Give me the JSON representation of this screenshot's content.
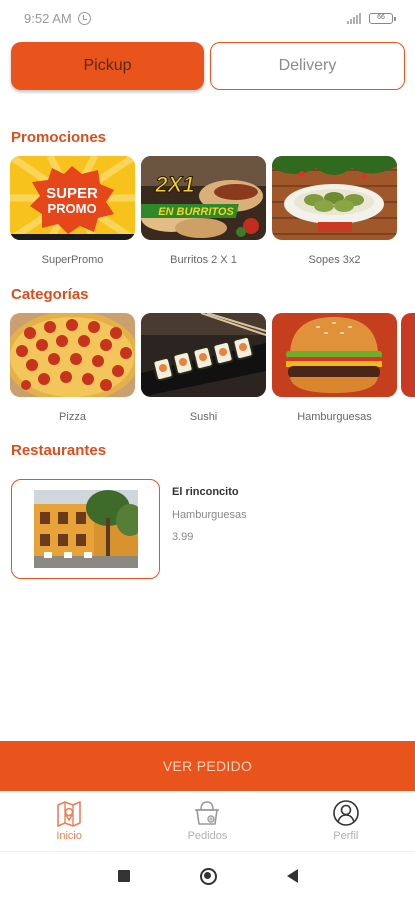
{
  "status_bar": {
    "time": "9:52 AM",
    "battery": "66"
  },
  "toggle": {
    "pickup": "Pickup",
    "delivery": "Delivery"
  },
  "sections": {
    "promotions": "Promociones",
    "categories": "Categorías",
    "restaurants": "Restaurantes"
  },
  "promotions": [
    {
      "label": "SuperPromo",
      "art_line1": "SUPER",
      "art_line2": "PROMO"
    },
    {
      "label": "Burritos 2 X 1",
      "art_line1": "2X1",
      "art_line2": "EN BURRITOS"
    },
    {
      "label": "Sopes 3x2"
    }
  ],
  "categories": [
    {
      "label": "Pizza"
    },
    {
      "label": "Sushi"
    },
    {
      "label": "Hamburguesas"
    }
  ],
  "restaurant": {
    "name": "El rinconcito",
    "category": "Hamburguesas",
    "price": "3.99"
  },
  "order_button": "VER PEDIDO",
  "bottom_nav": [
    {
      "label": "Inicio",
      "icon": "map-icon"
    },
    {
      "label": "Pedidos",
      "icon": "basket-icon"
    },
    {
      "label": "Perfil",
      "icon": "user-icon"
    }
  ],
  "colors": {
    "accent": "#e8541c",
    "section_title": "#d9501c"
  }
}
